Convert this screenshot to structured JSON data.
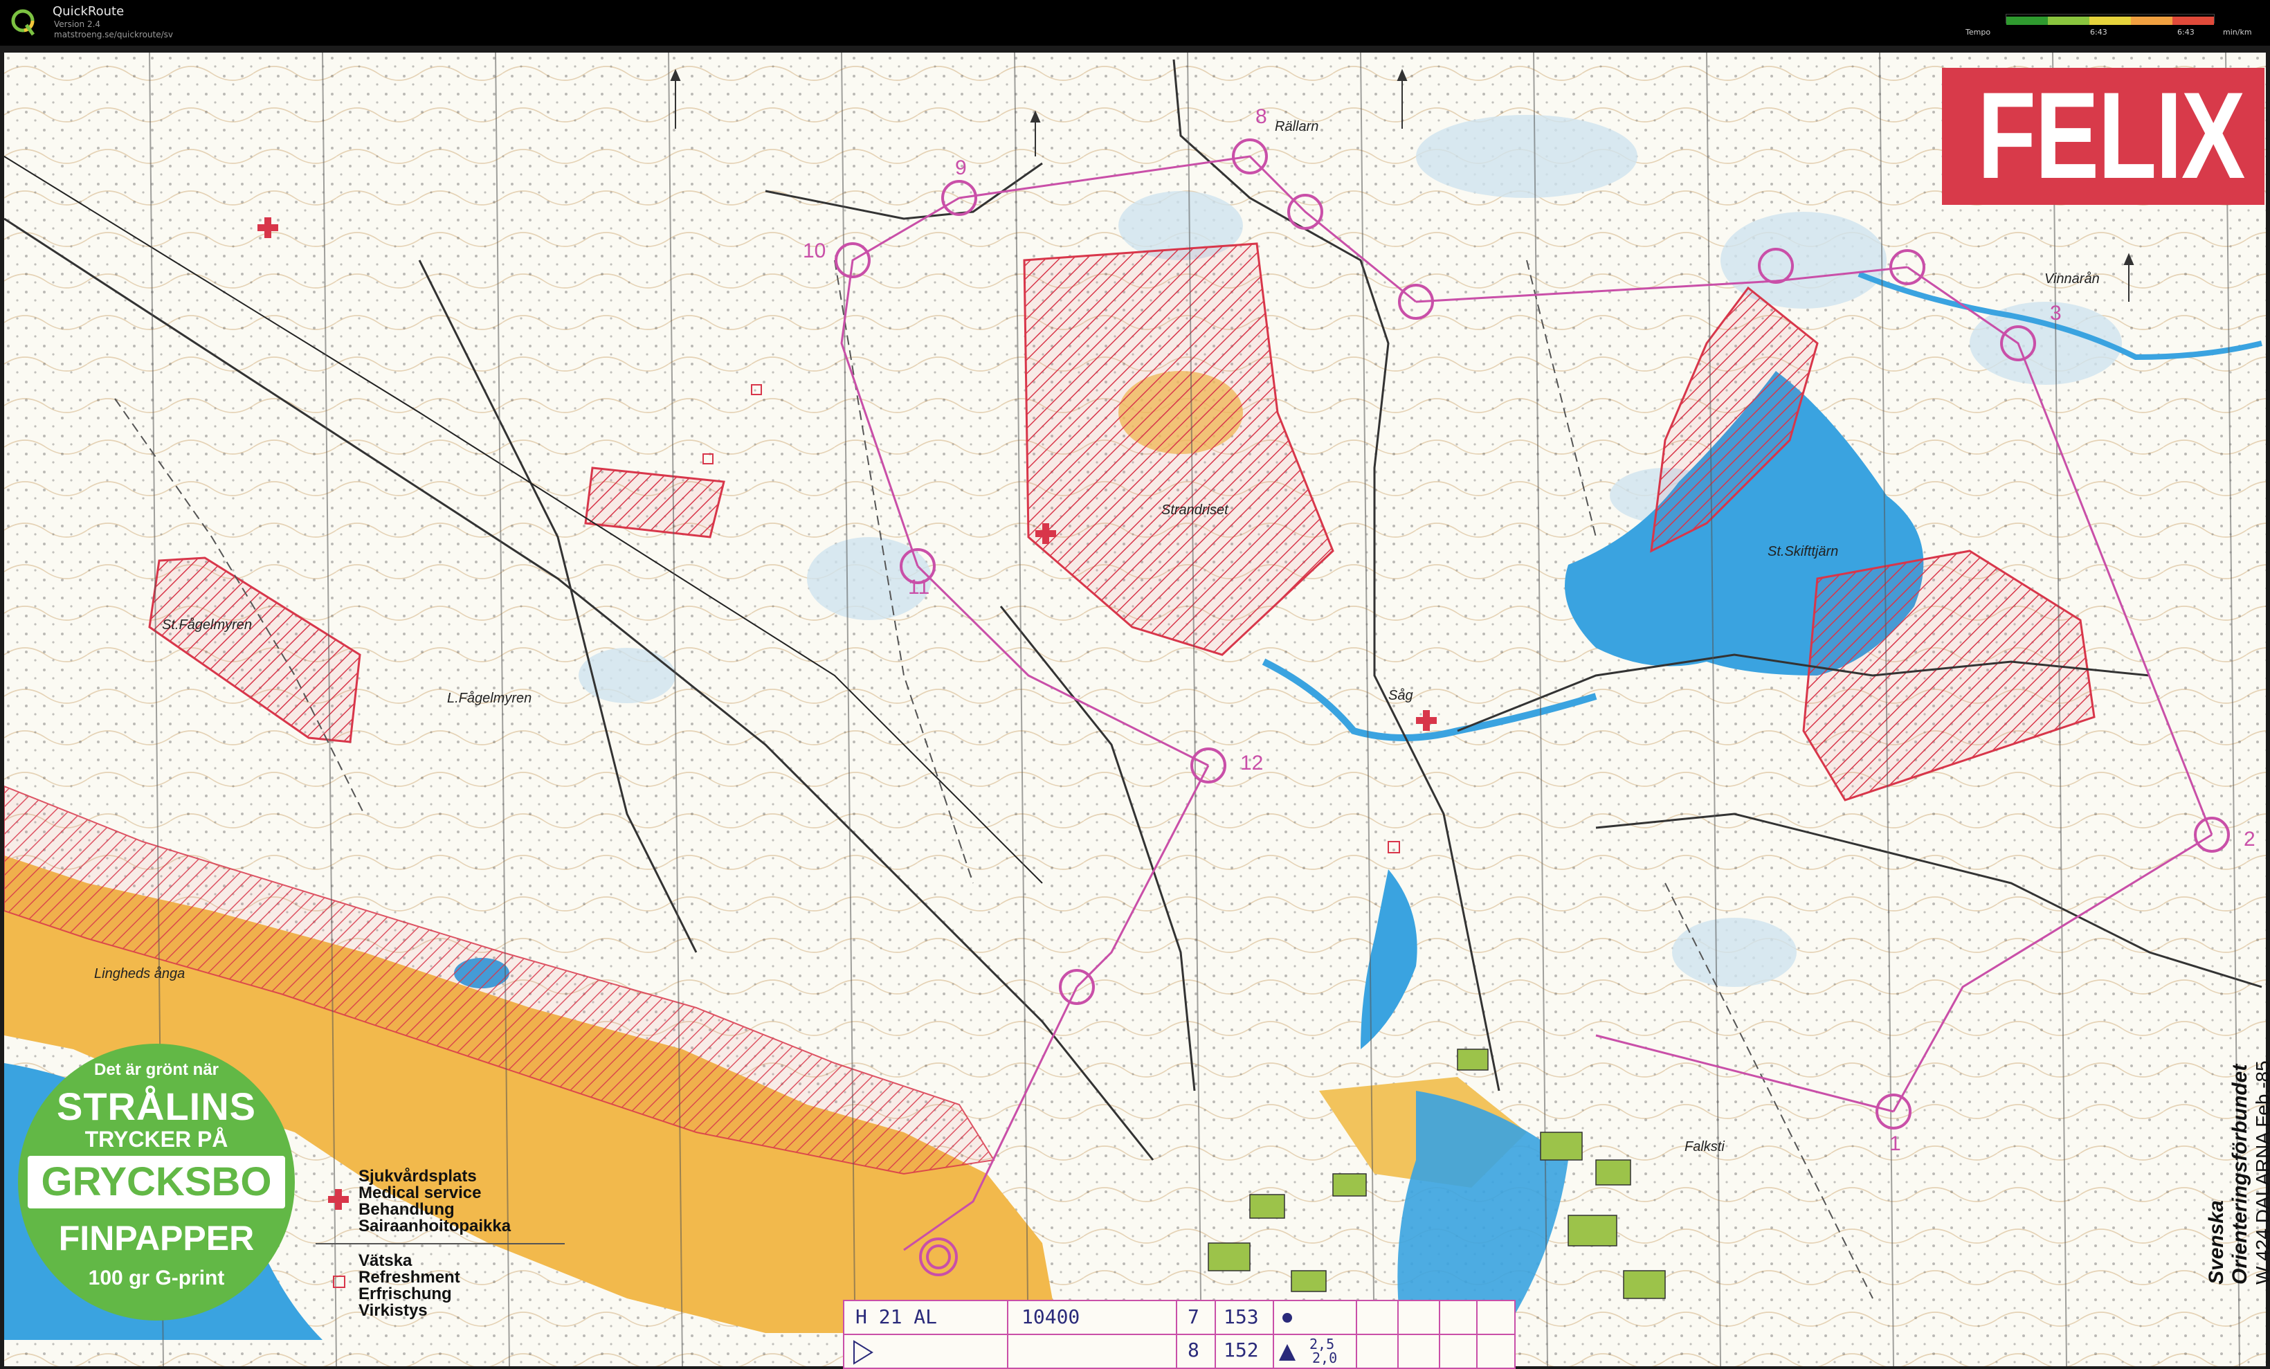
{
  "app": {
    "name": "QuickRoute",
    "version": "Version 2.4",
    "url": "matstroeng.se/quickroute/sv"
  },
  "legend": {
    "label": "Tempo",
    "value_left": "6:43",
    "value_right": "6:43",
    "unit": "min/km",
    "colors": [
      "#2f9a2f",
      "#8ac43e",
      "#e5d23c",
      "#f0a040",
      "#e04a3a"
    ]
  },
  "map": {
    "brand": "FELIX",
    "colors": {
      "water": "#3aa3e0",
      "field": "#f2b94c",
      "forbidden": "#d8364a",
      "course": "#c94fa8",
      "paper": "#fbfaf3"
    },
    "places": [
      {
        "id": "rallarn",
        "text": "Rällarn"
      },
      {
        "id": "strandriset",
        "text": "Strandriset"
      },
      {
        "id": "st-fagelmyren",
        "text": "St.Fågelmyren"
      },
      {
        "id": "l-fagelmyren",
        "text": "L.Fågelmyren"
      },
      {
        "id": "sag",
        "text": "Såg"
      },
      {
        "id": "st-skifttjarn",
        "text": "St.Skifttjärn"
      },
      {
        "id": "vinnaran",
        "text": "Vinnarån"
      },
      {
        "id": "lingheds-anga",
        "text": "Lingheds ånga"
      },
      {
        "id": "falksti",
        "text": "Falksti"
      }
    ],
    "control_numbers": [
      "8",
      "9",
      "10",
      "11",
      "12",
      "1",
      "2",
      "3"
    ],
    "sponsor": {
      "line1": "Det är grönt när",
      "line2": "STRÅLINS",
      "line3": "TRYCKER PÅ",
      "line4": "GRYCKSBO",
      "line5": "FINPAPPER",
      "line6": "100 gr G-print"
    },
    "map_legend": {
      "medical": [
        "Sjukvårdsplats",
        "Medical service",
        "Behandlung",
        "Sairaanhoitopaikka"
      ],
      "refreshment": [
        "Vätska",
        "Refreshment",
        "Erfrischung",
        "Virkistys"
      ]
    },
    "publisher": {
      "line1": "Svenska",
      "line2": "Orienteringsförbundet",
      "line3": "W 424 DALARNA Feb.-85"
    },
    "course_card": {
      "class": "H 21 AL",
      "length": "10400",
      "row1_a": "7",
      "row1_b": "153",
      "row2_a": "8",
      "row2_b": "152",
      "scale_a": "2,5",
      "scale_b": "2,0"
    }
  }
}
